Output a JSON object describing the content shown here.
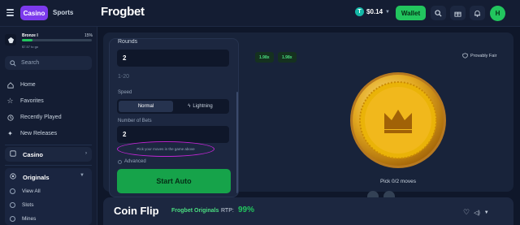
{
  "topbar": {
    "tabs": [
      "Casino",
      "Sports"
    ],
    "logo": "Frogbet",
    "balance": "$0.14",
    "currency_badge": "T",
    "wallet_label": "Wallet",
    "avatar_initial": "H"
  },
  "sidebar": {
    "rank": {
      "name": "Bronze I",
      "percent_label": "15%",
      "progress": 0.15,
      "next": "$7.57 to go"
    },
    "search_label": "Search",
    "nav": [
      "Home",
      "Favorites",
      "Recently Played",
      "New Releases"
    ],
    "casino_label": "Casino",
    "originals_label": "Originals",
    "originals_items": [
      "View All",
      "Slots",
      "Mines"
    ]
  },
  "panel": {
    "rounds_label": "Rounds",
    "rounds_value": "2",
    "rounds_range": "1-20",
    "speed_label": "Speed",
    "speed_options": [
      "Normal",
      "Lightning"
    ],
    "bets_label": "Number of Bets",
    "bets_value": "2",
    "hint": "Pick your moves in the game above",
    "advanced_label": "Advanced",
    "start_label": "Start Auto"
  },
  "game": {
    "multipliers": [
      "1.98x",
      "1.98x"
    ],
    "provably_fair": "Provably Fair",
    "pick_text": "Pick 0/2 moves"
  },
  "info": {
    "title": "Coin Flip",
    "provider": "Frogbet Originals",
    "rtp_label": "RTP:",
    "rtp_value": "99%"
  },
  "colors": {
    "accent_green": "#22c55e",
    "casino_purple": "#7c3aed",
    "coin_gold": "#e2a820"
  }
}
